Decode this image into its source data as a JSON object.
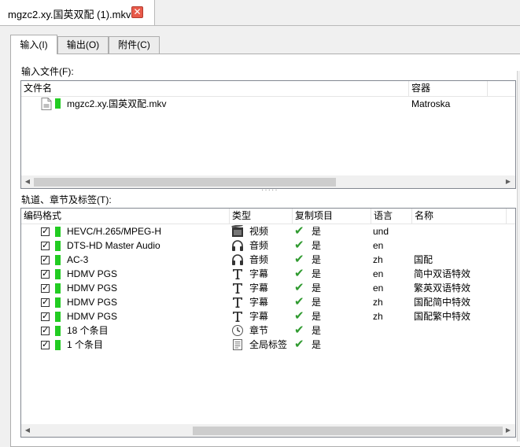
{
  "document_tab": {
    "title": "mgzc2.xy.国英双配 (1).mkv",
    "close_symbol": "✕"
  },
  "tabs": [
    {
      "label": "输入(I)"
    },
    {
      "label": "输出(O)"
    },
    {
      "label": "附件(C)"
    }
  ],
  "input_files": {
    "label": "输入文件(F):",
    "columns": [
      "文件名",
      "容器"
    ],
    "rows": [
      {
        "name": "mgzc2.xy.国英双配.mkv",
        "container": "Matroska"
      }
    ]
  },
  "tracks": {
    "label": "轨道、章节及标签(T):",
    "columns": [
      "编码格式",
      "类型",
      "复制项目",
      "语言",
      "名称"
    ],
    "rows": [
      {
        "codec": "HEVC/H.265/MPEG-H",
        "type": "视频",
        "type_icon": "film-icon",
        "copy": "是",
        "lang": "und",
        "name": ""
      },
      {
        "codec": "DTS-HD Master Audio",
        "type": "音频",
        "type_icon": "headphones-icon",
        "copy": "是",
        "lang": "en",
        "name": ""
      },
      {
        "codec": "AC-3",
        "type": "音频",
        "type_icon": "headphones-icon",
        "copy": "是",
        "lang": "zh",
        "name": "国配"
      },
      {
        "codec": "HDMV PGS",
        "type": "字幕",
        "type_icon": "subtitle-icon",
        "copy": "是",
        "lang": "en",
        "name": "简中双语特效"
      },
      {
        "codec": "HDMV PGS",
        "type": "字幕",
        "type_icon": "subtitle-icon",
        "copy": "是",
        "lang": "en",
        "name": "繁英双语特效"
      },
      {
        "codec": "HDMV PGS",
        "type": "字幕",
        "type_icon": "subtitle-icon",
        "copy": "是",
        "lang": "zh",
        "name": "国配简中特效"
      },
      {
        "codec": "HDMV PGS",
        "type": "字幕",
        "type_icon": "subtitle-icon",
        "copy": "是",
        "lang": "zh",
        "name": "国配繁中特效"
      },
      {
        "codec": "18 个条目",
        "type": "章节",
        "type_icon": "clock-icon",
        "copy": "是",
        "lang": "",
        "name": ""
      },
      {
        "codec": "1 个条目",
        "type": "全局标签",
        "type_icon": "document-icon",
        "copy": "是",
        "lang": "",
        "name": ""
      }
    ]
  },
  "colors": {
    "track_marker": "#22cc22",
    "copy_tick": "#2f9a2f",
    "close_button": "#e85a4a"
  }
}
